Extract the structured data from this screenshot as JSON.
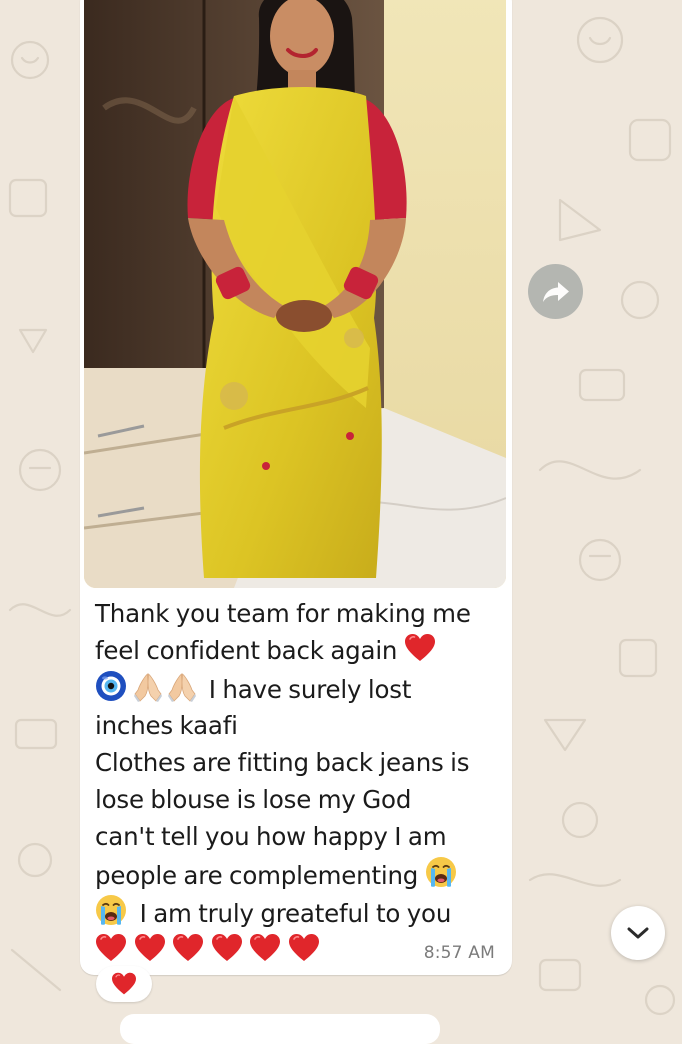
{
  "message": {
    "caption_lines": [
      "Thank you team for making me",
      "feel confident back again",
      "I have surely lost",
      "inches kaafi",
      "Clothes are fitting back jeans is",
      "lose blouse is lose my God",
      "can't tell you how happy I am",
      "people are complementing",
      "I am truly greateful to you"
    ],
    "time": "8:57 AM",
    "reaction": "red-heart"
  },
  "icons": {
    "forward": "forward-share-icon",
    "scroll_down": "chevron-down-icon"
  },
  "colors": {
    "chat_background": "#efe7dc",
    "bubble": "#ffffff",
    "heart": "#e0262b",
    "saree": "#e2cf2a",
    "blouse": "#c8233a"
  }
}
